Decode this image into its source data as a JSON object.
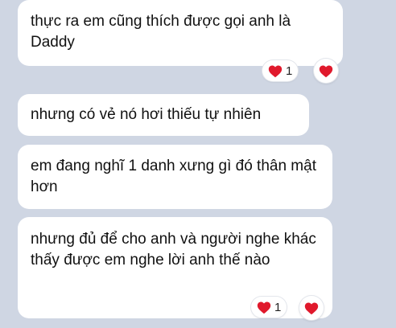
{
  "messages": [
    {
      "text": "thực ra em cũng thích được gọi anh là Daddy",
      "reaction": {
        "icon": "heart-icon",
        "count": "1"
      }
    },
    {
      "text": "nhưng có vẻ nó hơi thiếu tự nhiên"
    },
    {
      "text": "em đang nghĩ 1 danh xưng gì đó thân mật hơn"
    },
    {
      "text": "nhưng đủ để cho anh và người nghe khác thấy được em nghe lời anh thế nào",
      "reaction": {
        "icon": "heart-icon",
        "count": "1"
      }
    }
  ],
  "colors": {
    "background": "#cfd6e3",
    "bubble": "#ffffff",
    "heart": "#e0192c"
  }
}
